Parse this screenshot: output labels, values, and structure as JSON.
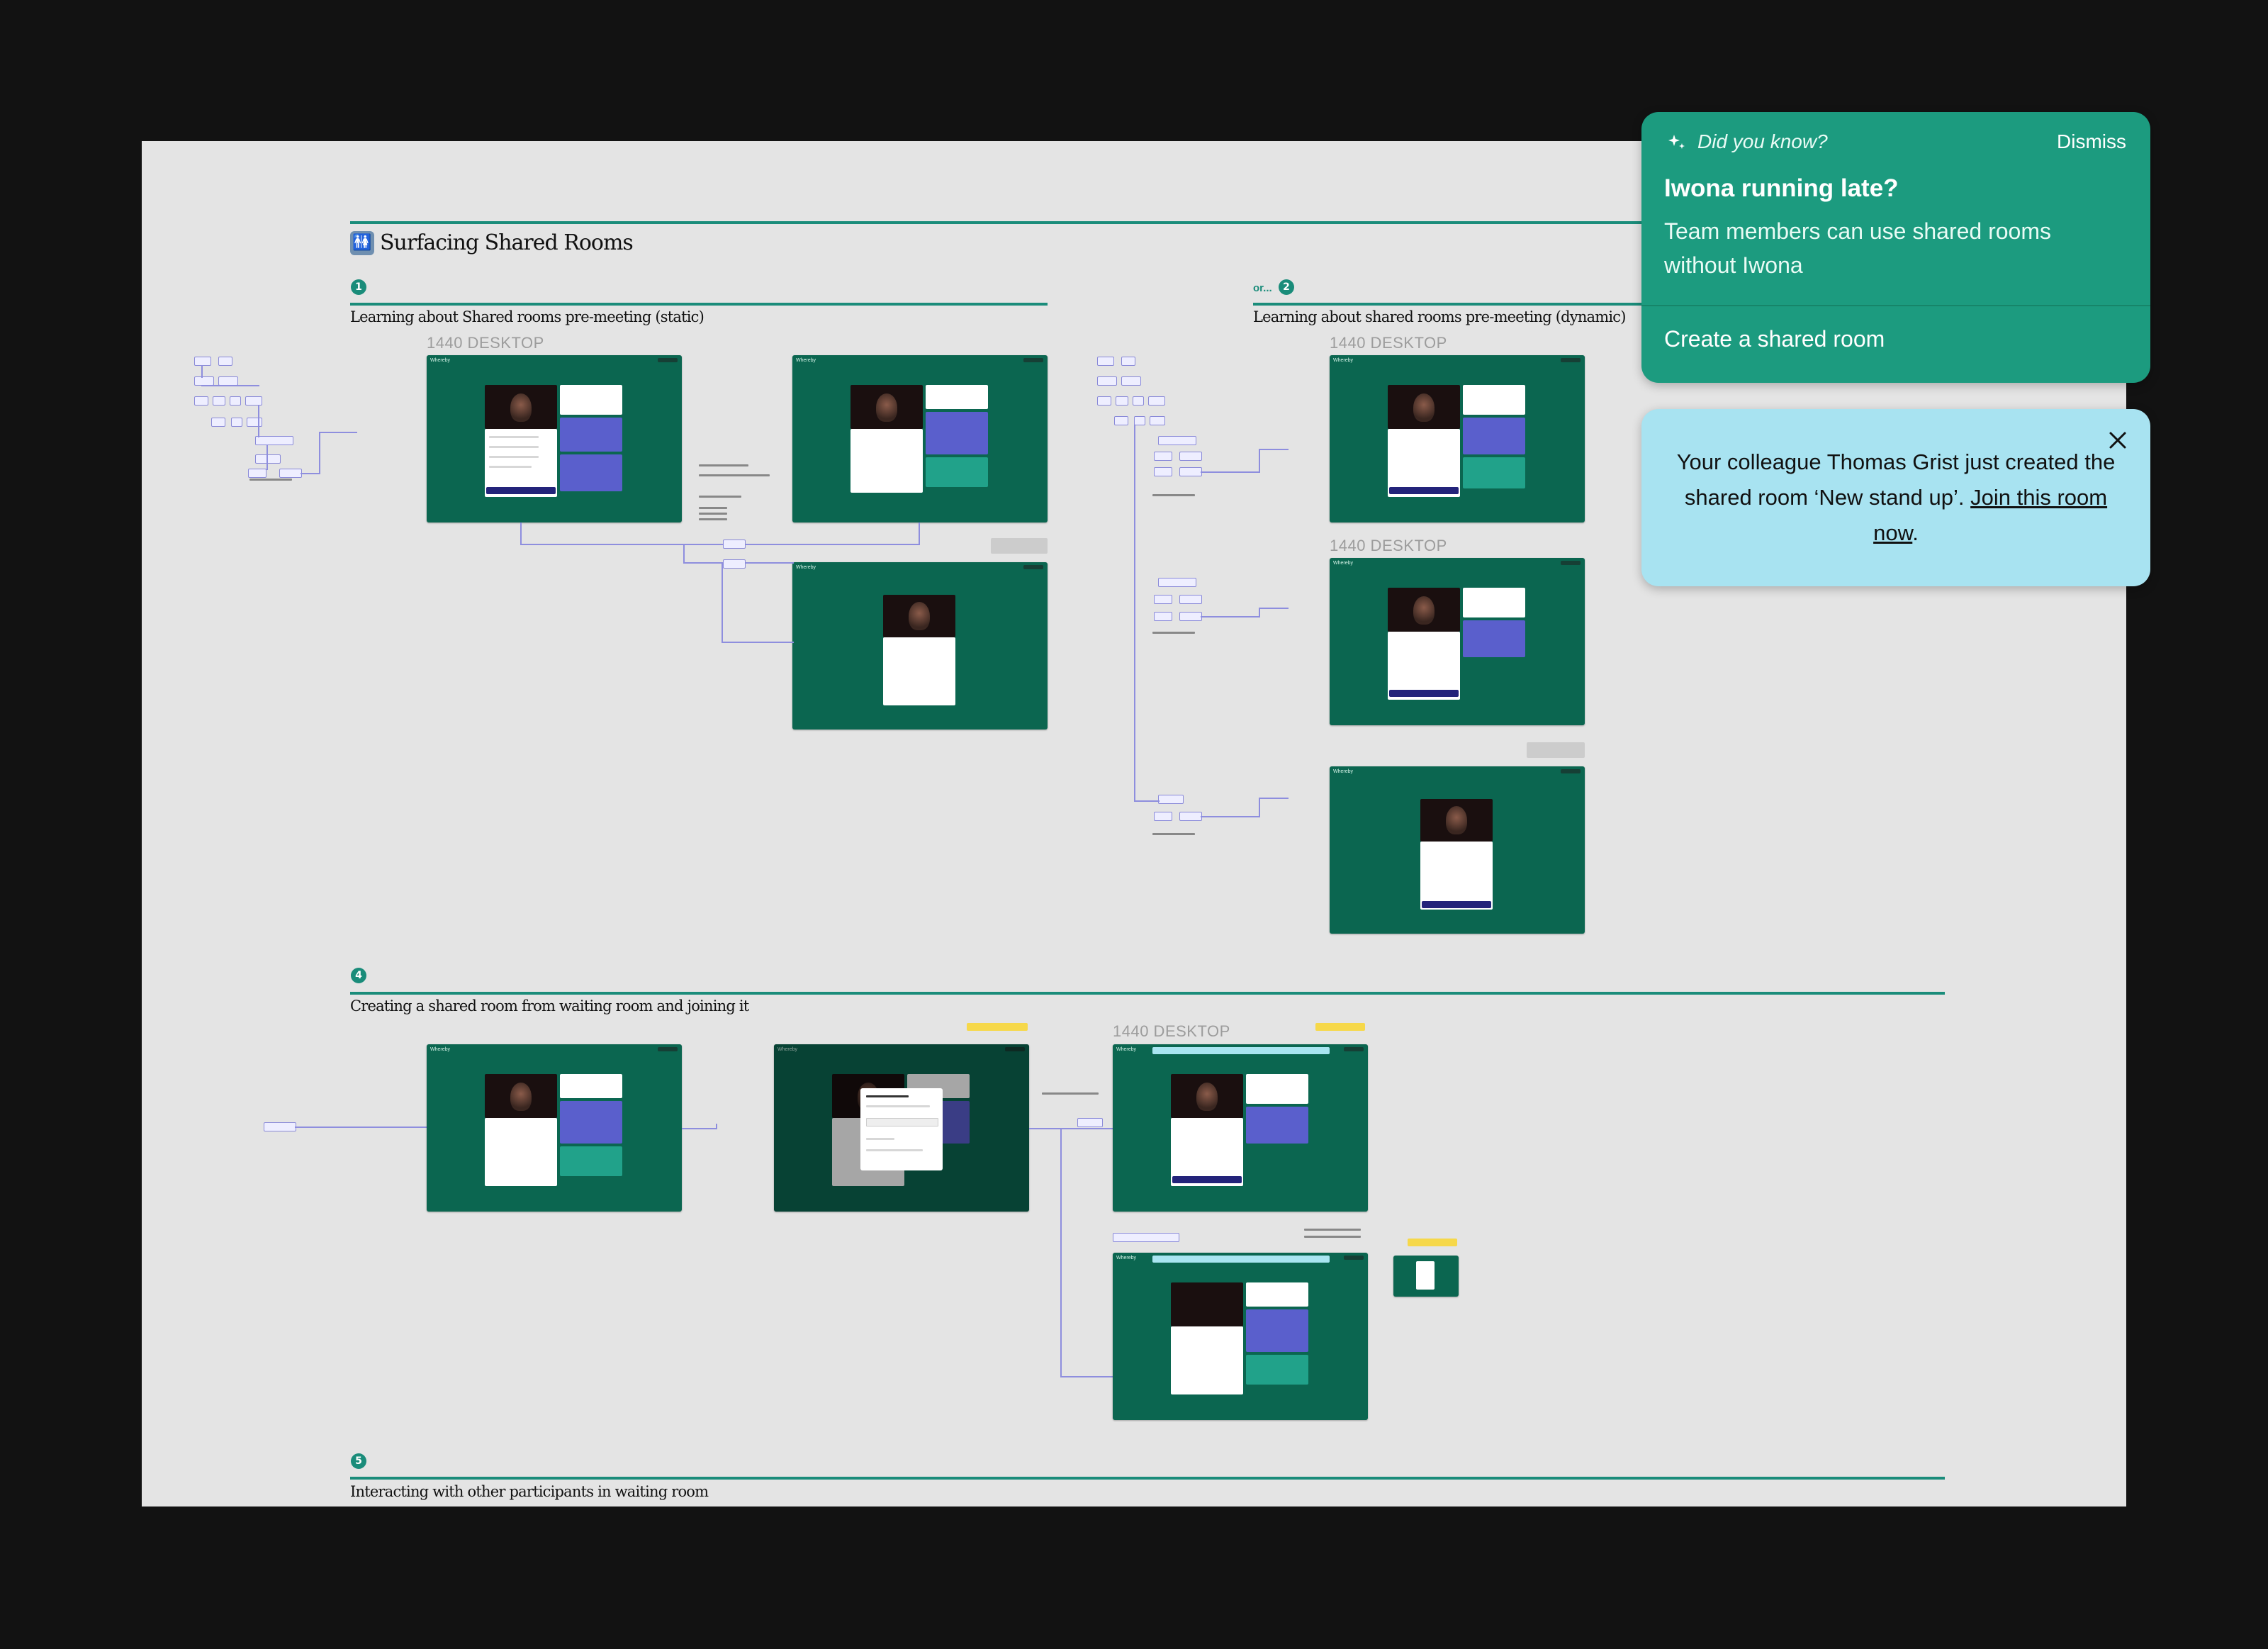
{
  "board": {
    "title_emoji": "🚻",
    "title": "Surfacing Shared Rooms",
    "sections": [
      {
        "num": "1",
        "title": "Learning about Shared rooms pre-meeting (static)"
      },
      {
        "num": "2",
        "prefix": "or...",
        "title": "Learning about shared rooms pre-meeting (dynamic)"
      },
      {
        "num": "4",
        "title": "Creating a shared room from waiting room and joining it"
      },
      {
        "num": "5",
        "title": "Interacting with other participants in waiting room"
      }
    ],
    "frame_label": "1440 DESKTOP",
    "frame_brand": "Whereby"
  },
  "tip_card": {
    "kicker": "Did you know?",
    "dismiss_label": "Dismiss",
    "headline": "Iwona running late?",
    "body": "Team members can use shared rooms without Iwona",
    "action_label": "Create a shared room",
    "bg_color": "#1c9b7f"
  },
  "notice_card": {
    "message_pre": "Your colleague Thomas Grist just created the shared room ‘New stand up’.",
    "link_text": "Join this room now",
    "message_post": ".",
    "bg_color": "#a8e3f1"
  },
  "icons": {
    "sparkle": "sparkle-icon",
    "close": "close-icon"
  }
}
